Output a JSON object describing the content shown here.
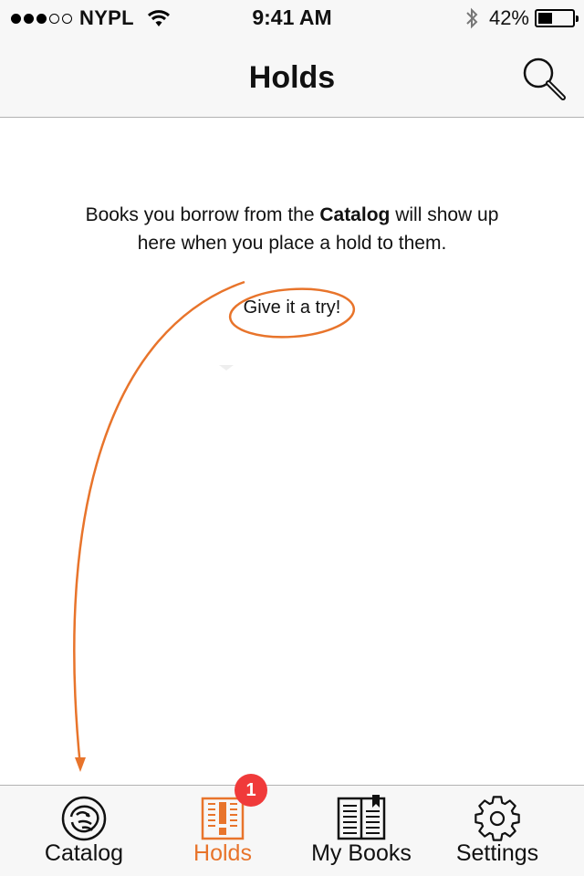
{
  "status_bar": {
    "carrier": "NYPL",
    "time": "9:41 AM",
    "battery_percent": "42%",
    "battery_level": 0.42,
    "signal_bars_filled": 3,
    "signal_bars_total": 5
  },
  "nav": {
    "title": "Holds",
    "search_icon": "search-icon"
  },
  "empty_state": {
    "text_before": "Books you borrow from the ",
    "text_bold": "Catalog",
    "text_after": " will show up here when you place a hold to them.",
    "prompt": "Give it a try!"
  },
  "colors": {
    "accent": "#e8742b",
    "badge": "#f03a3a"
  },
  "tabs": [
    {
      "label": "Catalog",
      "icon": "lion-icon",
      "active": false
    },
    {
      "label": "Holds",
      "icon": "holds-icon",
      "active": true,
      "badge": "1"
    },
    {
      "label": "My Books",
      "icon": "book-icon",
      "active": false
    },
    {
      "label": "Settings",
      "icon": "gear-icon",
      "active": false
    }
  ]
}
